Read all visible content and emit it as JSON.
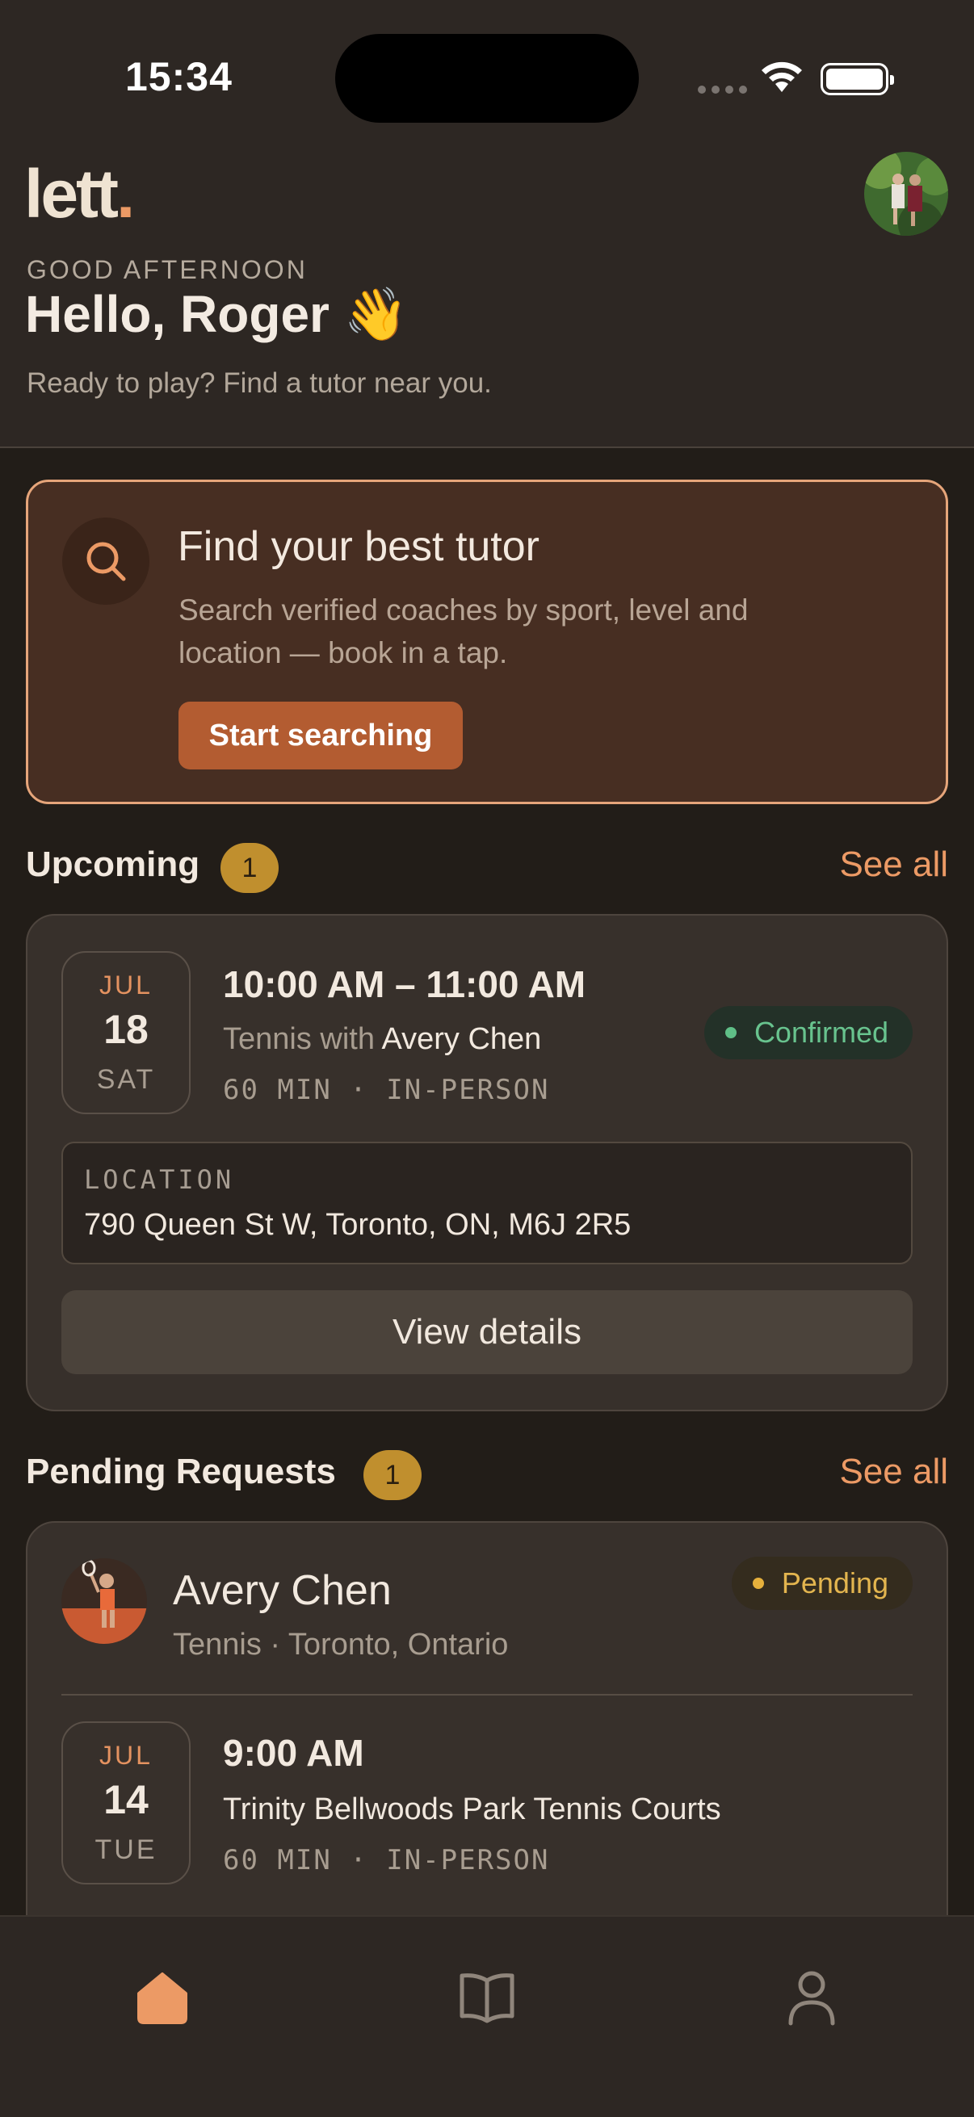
{
  "status_bar": {
    "time": "15:34"
  },
  "header": {
    "logo": "lett",
    "logo_dot": ".",
    "kicker": "GOOD AFTERNOON",
    "title": "Hello, Roger 👋",
    "subtitle": "Ready to play? Find a tutor near you."
  },
  "promo": {
    "title": "Find your best tutor",
    "description": "Search verified coaches by sport, level and location — book in a tap.",
    "button": "Start searching"
  },
  "upcoming": {
    "title": "Upcoming",
    "count": "1",
    "see_all": "See all",
    "item": {
      "month": "JUL",
      "day": "18",
      "weekday": "SAT",
      "time": "10:00 AM – 11:00 AM",
      "sport_prefix": "Tennis with",
      "coach": "Avery Chen",
      "meta": "60 MIN · IN-PERSON",
      "status": "Confirmed",
      "location_label": "LOCATION",
      "location": "790 Queen St W, Toronto, ON, M6J 2R5",
      "button": "View details"
    }
  },
  "pending": {
    "title": "Pending Requests",
    "count": "1",
    "see_all": "See all",
    "item": {
      "name": "Avery Chen",
      "subtitle": "Tennis · Toronto, Ontario",
      "status": "Pending",
      "month": "JUL",
      "day": "14",
      "weekday": "TUE",
      "time": "9:00 AM",
      "place": "Trinity Bellwoods Park Tennis Courts",
      "meta": "60 MIN · IN-PERSON"
    }
  },
  "tabbar": {
    "items": [
      {
        "icon": "home-icon",
        "active": true
      },
      {
        "icon": "book-icon",
        "active": false
      },
      {
        "icon": "profile-icon",
        "active": false
      }
    ]
  },
  "colors": {
    "accent": "#ec9a65",
    "background": "#221d18",
    "confirmed": "#68c38e",
    "pending": "#e3b54f"
  }
}
